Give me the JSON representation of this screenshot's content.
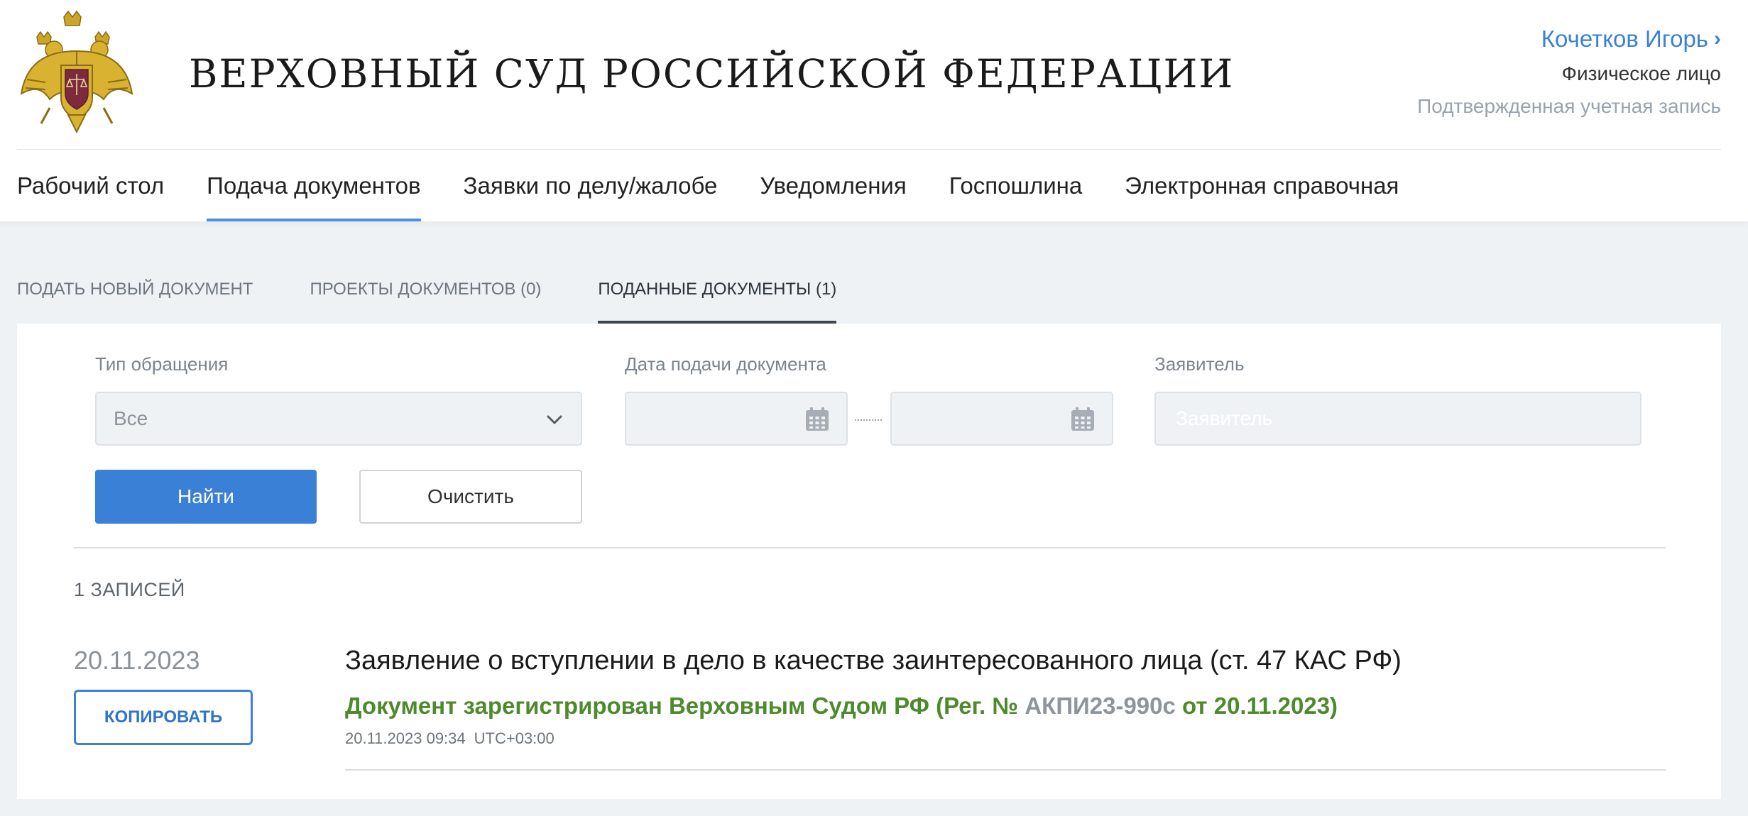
{
  "header": {
    "site_title": "ВЕРХОВНЫЙ СУД РОССИЙСКОЙ ФЕДЕРАЦИИ",
    "user": {
      "name": "Кочетков Игорь",
      "type": "Физическое лицо",
      "status": "Подтвержденная учетная запись"
    }
  },
  "main_nav": [
    {
      "label": "Рабочий стол",
      "active": false
    },
    {
      "label": "Подача документов",
      "active": true
    },
    {
      "label": "Заявки по делу/жалобе",
      "active": false
    },
    {
      "label": "Уведомления",
      "active": false
    },
    {
      "label": "Госпошлина",
      "active": false
    },
    {
      "label": "Электронная справочная",
      "active": false
    }
  ],
  "sub_tabs": [
    {
      "label": "ПОДАТЬ НОВЫЙ ДОКУМЕНТ",
      "active": false
    },
    {
      "label": "ПРОЕКТЫ ДОКУМЕНТОВ (0)",
      "active": false
    },
    {
      "label": "ПОДАННЫЕ ДОКУМЕНТЫ (1)",
      "active": true
    }
  ],
  "filters": {
    "appeal_type": {
      "label": "Тип обращения",
      "value": "Все"
    },
    "submit_date": {
      "label": "Дата подачи документа",
      "from": "",
      "to": ""
    },
    "applicant": {
      "label": "Заявитель",
      "placeholder": "Заявитель",
      "value": ""
    },
    "search_label": "Найти",
    "clear_label": "Очистить"
  },
  "results": {
    "count_label": "1 ЗАПИСЕЙ",
    "items": [
      {
        "date": "20.11.2023",
        "copy_label": "КОПИРОВАТЬ",
        "title": "Заявление о вступлении в дело в качестве заинтересованного лица (ст. 47 КАС РФ)",
        "status_prefix": "Документ зарегистрирован Верховным Судом РФ  (Рег. № ",
        "reg_number": "АКПИ23-990с",
        "status_suffix": " от 20.11.2023)",
        "datetime": "20.11.2023 09:34",
        "timezone": "UTC+03:00"
      }
    ]
  },
  "colors": {
    "accent": "#3b80d7",
    "status_green": "#4c8a2c",
    "page_bg": "#eff2f5"
  },
  "icons": [
    "coat-of-arms-emblem",
    "chevron-right-icon",
    "chevron-down-icon",
    "calendar-icon"
  ]
}
